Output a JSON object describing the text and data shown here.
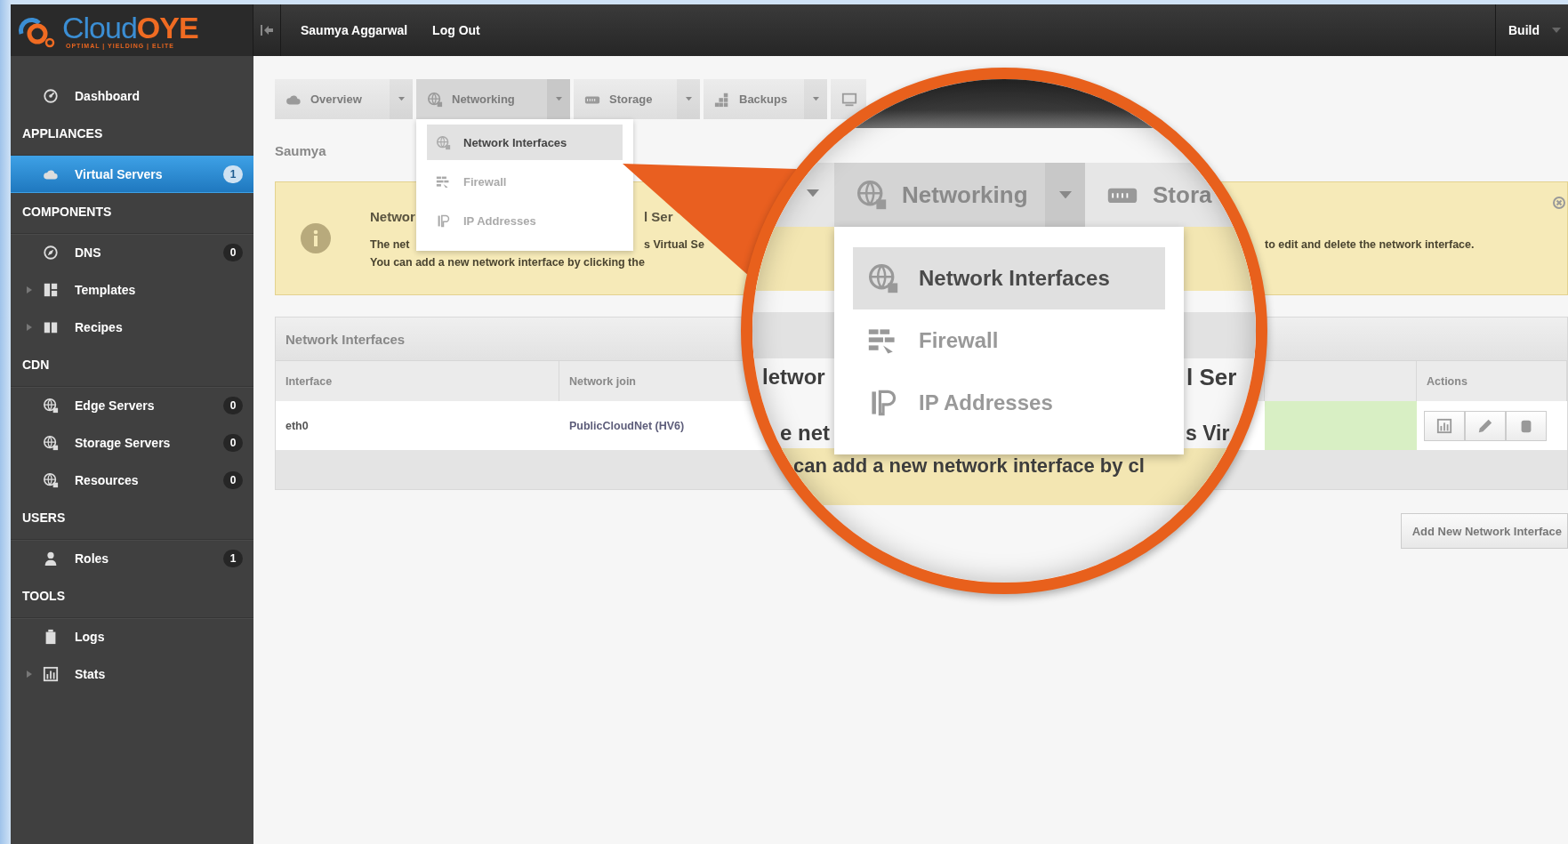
{
  "logo": {
    "brand_main": "Cloud",
    "brand_accent": "OYE",
    "tagline": "OPTIMAL | YIELDING | ELITE"
  },
  "topbar": {
    "user": "Saumya Aggarwal",
    "logout": "Log Out",
    "build": "Build"
  },
  "sidebar": [
    {
      "kind": "item",
      "label": "Dashboard",
      "expandable": false,
      "selected": false
    },
    {
      "kind": "header",
      "label": "APPLIANCES"
    },
    {
      "kind": "item",
      "label": "Virtual Servers",
      "count": "1",
      "expandable": false,
      "selected": true
    },
    {
      "kind": "header",
      "label": "COMPONENTS"
    },
    {
      "kind": "item",
      "label": "DNS",
      "count": "0",
      "expandable": false,
      "selected": false
    },
    {
      "kind": "item",
      "label": "Templates",
      "expandable": true,
      "selected": false
    },
    {
      "kind": "item",
      "label": "Recipes",
      "expandable": true,
      "selected": false
    },
    {
      "kind": "header",
      "label": "CDN"
    },
    {
      "kind": "item",
      "label": "Edge Servers",
      "count": "0",
      "expandable": false,
      "selected": false
    },
    {
      "kind": "item",
      "label": "Storage Servers",
      "count": "0",
      "expandable": false,
      "selected": false
    },
    {
      "kind": "item",
      "label": "Resources",
      "count": "0",
      "expandable": false,
      "selected": false
    },
    {
      "kind": "header",
      "label": "USERS"
    },
    {
      "kind": "item",
      "label": "Roles",
      "count": "1",
      "expandable": false,
      "selected": false
    },
    {
      "kind": "header",
      "label": "TOOLS"
    },
    {
      "kind": "item",
      "label": "Logs",
      "expandable": false,
      "selected": false
    },
    {
      "kind": "item",
      "label": "Stats",
      "expandable": true,
      "selected": false
    }
  ],
  "tabs": [
    {
      "label": "Overview",
      "selected": false
    },
    {
      "label": "Networking",
      "selected": true
    },
    {
      "label": "Storage",
      "selected": false
    },
    {
      "label": "Backups",
      "selected": false
    }
  ],
  "dropdown": [
    {
      "label": "Network Interfaces",
      "selected": true
    },
    {
      "label": "Firewall",
      "selected": false
    },
    {
      "label": "IP Addresses",
      "selected": false
    }
  ],
  "page_label": "Saumya",
  "info": {
    "lines": [
      [
        "Networ",
        "l Ser"
      ],
      [
        "The net",
        "s Virtual Se",
        "to edit and delete the network interface."
      ],
      [
        "You can add a new network interface by clicking the"
      ]
    ]
  },
  "table": {
    "title": "Network Interfaces",
    "columns": [
      "Interface",
      "Network join",
      "Actions"
    ],
    "rows": [
      {
        "cells": [
          "eth0",
          "PublicCloudNet (HV6)"
        ]
      }
    ]
  },
  "add_button": "Add New Network Interface",
  "lens": {
    "tabs": [
      {
        "label": "Networking",
        "selected": true
      },
      {
        "label": "Stora",
        "selected": false
      }
    ],
    "menu": [
      {
        "label": "Network Interfaces",
        "selected": true
      },
      {
        "label": "Firewall",
        "selected": false
      },
      {
        "label": "IP Addresses",
        "selected": false
      }
    ],
    "background": [
      "letwor",
      "l Ser",
      "e net",
      "s Vir",
      "can add a new network interface by cl"
    ]
  }
}
